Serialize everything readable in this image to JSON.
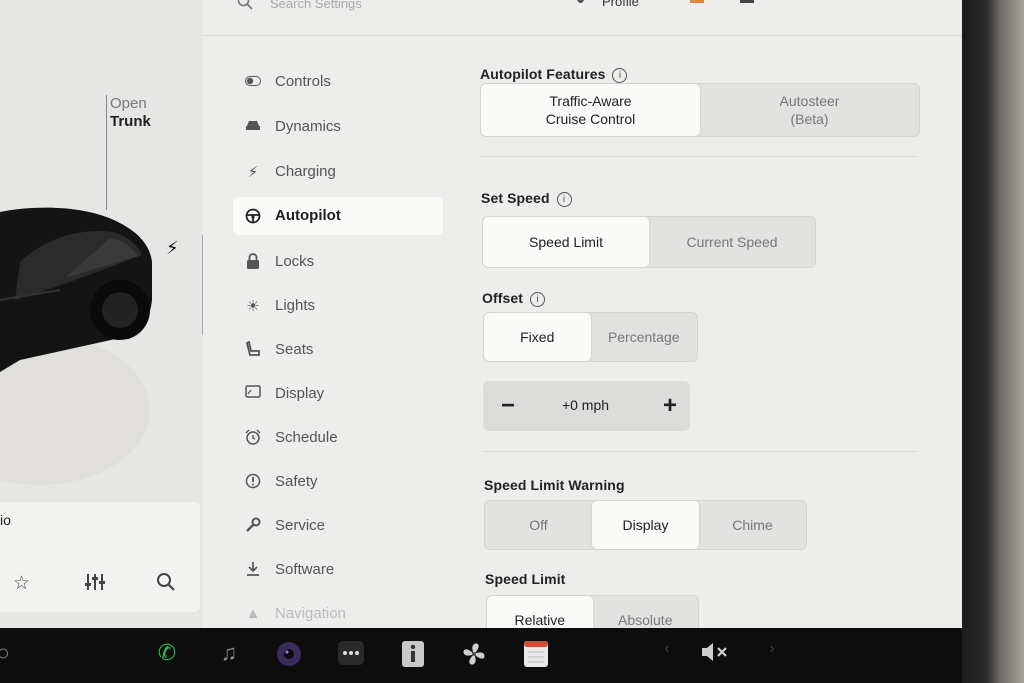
{
  "colors": {
    "accent_orange": "#e8833a",
    "phone_green": "#2fbf4f",
    "screen_bg": "#ededeb",
    "selected_bg": "#fafaf9"
  },
  "top_bar": {
    "search_placeholder": "Search Settings",
    "profile_label": "Profile",
    "profile_icon": "person-icon"
  },
  "car_panel": {
    "trunk_state": "Open",
    "trunk_label": "Trunk",
    "charge_icon": "lightning-icon",
    "media_title_fragment": "io",
    "media_icons": [
      "star-icon",
      "equalizer-icon",
      "search-icon"
    ]
  },
  "nav": {
    "items": [
      {
        "label": "Controls",
        "icon": "toggle-icon"
      },
      {
        "label": "Dynamics",
        "icon": "car-icon"
      },
      {
        "label": "Charging",
        "icon": "lightning-icon"
      },
      {
        "label": "Autopilot",
        "icon": "steering-wheel-icon"
      },
      {
        "label": "Locks",
        "icon": "lock-icon"
      },
      {
        "label": "Lights",
        "icon": "bulb-icon"
      },
      {
        "label": "Seats",
        "icon": "seat-icon"
      },
      {
        "label": "Display",
        "icon": "display-icon"
      },
      {
        "label": "Schedule",
        "icon": "alarm-clock-icon"
      },
      {
        "label": "Safety",
        "icon": "alert-icon"
      },
      {
        "label": "Service",
        "icon": "wrench-icon"
      },
      {
        "label": "Software",
        "icon": "download-icon"
      },
      {
        "label": "Navigation",
        "icon": "navigation-arrow-icon"
      }
    ],
    "active": "Autopilot"
  },
  "autopilot_features": {
    "label": "Autopilot Features",
    "options": [
      "Traffic-Aware\nCruise Control",
      "Autosteer\n(Beta)"
    ],
    "selected": "Traffic-Aware Cruise Control"
  },
  "set_speed": {
    "label": "Set Speed",
    "options": [
      "Speed Limit",
      "Current Speed"
    ],
    "selected": "Speed Limit"
  },
  "offset": {
    "label": "Offset",
    "options": [
      "Fixed",
      "Percentage"
    ],
    "selected": "Fixed",
    "value": "+0 mph",
    "minus": "−",
    "plus": "+"
  },
  "speed_limit_warning": {
    "label": "Speed Limit Warning",
    "options": [
      "Off",
      "Display",
      "Chime"
    ],
    "selected": "Display"
  },
  "speed_limit": {
    "label": "Speed Limit",
    "options": [
      "Relative",
      "Absolute"
    ],
    "selected": "Relative"
  },
  "taskbar": {
    "icons": [
      "phone-icon",
      "music-icon",
      "camera-icon",
      "more-apps-icon",
      "manual-icon",
      "fan-icon",
      "calendar-icon",
      "volume-mute-icon"
    ]
  }
}
